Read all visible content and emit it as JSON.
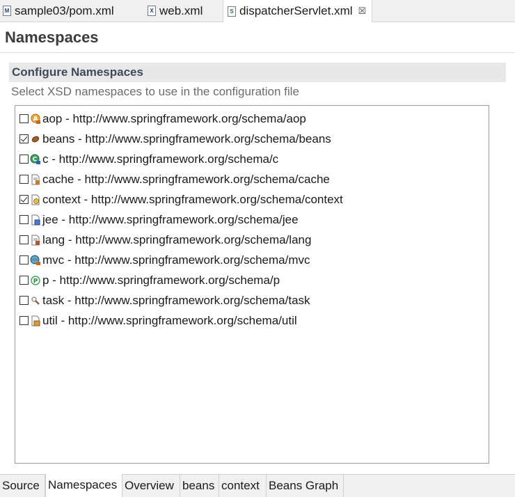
{
  "editor_tabs": [
    {
      "icon": "maven-pom-icon",
      "label": "sample03/pom.xml"
    },
    {
      "icon": "xml-file-icon",
      "label": "web.xml"
    },
    {
      "icon": "spring-config-icon",
      "label": "dispatcherServlet.xml",
      "close": "☒"
    }
  ],
  "header": {
    "title": "Namespaces"
  },
  "section": {
    "title": "Configure Namespaces",
    "description": "Select XSD namespaces to use in the configuration file"
  },
  "namespaces": [
    {
      "label": "aop - http://www.springframework.org/schema/aop",
      "checked": false,
      "icon": "aop-icon"
    },
    {
      "label": "beans - http://www.springframework.org/schema/beans",
      "checked": true,
      "icon": "bean-icon"
    },
    {
      "label": "c - http://www.springframework.org/schema/c",
      "checked": false,
      "icon": "c-namespace-icon"
    },
    {
      "label": "cache - http://www.springframework.org/schema/cache",
      "checked": false,
      "icon": "cache-icon"
    },
    {
      "label": "context - http://www.springframework.org/schema/context",
      "checked": true,
      "icon": "context-icon"
    },
    {
      "label": "jee - http://www.springframework.org/schema/jee",
      "checked": false,
      "icon": "jee-icon"
    },
    {
      "label": "lang - http://www.springframework.org/schema/lang",
      "checked": false,
      "icon": "lang-icon"
    },
    {
      "label": "mvc - http://www.springframework.org/schema/mvc",
      "checked": false,
      "icon": "mvc-icon"
    },
    {
      "label": "p - http://www.springframework.org/schema/p",
      "checked": false,
      "icon": "p-namespace-icon"
    },
    {
      "label": "task - http://www.springframework.org/schema/task",
      "checked": false,
      "icon": "task-icon"
    },
    {
      "label": "util - http://www.springframework.org/schema/util",
      "checked": false,
      "icon": "util-icon"
    }
  ],
  "bottom_tabs": [
    "Source",
    "Namespaces",
    "Overview",
    "beans",
    "context",
    "Beans Graph"
  ],
  "active_bottom_tab": "Namespaces",
  "colors": {
    "section_title": "#3e4a5a",
    "description": "#6b6b6b",
    "tab_bar": "#f0f0f0"
  }
}
